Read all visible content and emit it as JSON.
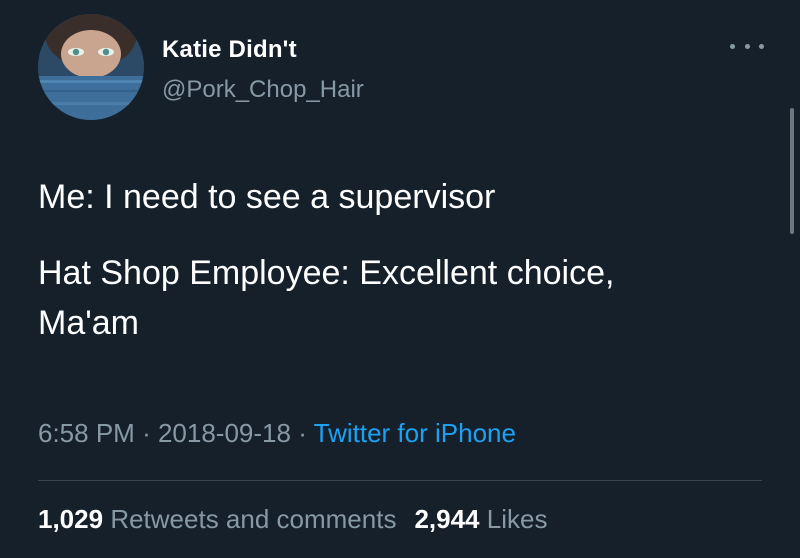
{
  "user": {
    "display_name": "Katie Didn't",
    "handle": "@Pork_Chop_Hair"
  },
  "menu": {
    "icon": "more-horizontal-icon"
  },
  "tweet": {
    "line1": "Me: I need to see a supervisor",
    "line2": "Hat Shop Employee: Excellent choice,",
    "line3": "Ma'am"
  },
  "meta": {
    "time": "6:58 PM",
    "sep": "·",
    "date": "2018-09-18",
    "source": "Twitter for iPhone"
  },
  "stats": {
    "retweets_count": "1,029",
    "retweets_label": "Retweets and comments",
    "likes_count": "2,944",
    "likes_label": "Likes"
  },
  "colors": {
    "background": "#15202b",
    "secondary_text": "#8899a6",
    "link": "#1da1f2"
  }
}
